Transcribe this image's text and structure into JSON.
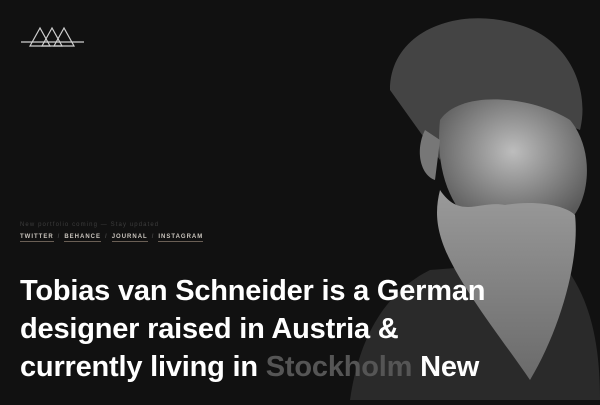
{
  "logo": {
    "icon": "triangles-logo-icon"
  },
  "hero": {
    "tagline": "New portfolio coming — Stay updated",
    "links": [
      "TWITTER",
      "BEHANCE",
      "JOURNAL",
      "INSTAGRAM"
    ],
    "separator": "/",
    "headline_before": "Tobias van Schneider is a German designer raised in Austria & currently living in ",
    "headline_highlight": "Stockholm",
    "headline_after": " New"
  },
  "colors": {
    "background": "#111111",
    "text": "#ffffff",
    "highlight": "#555555"
  }
}
